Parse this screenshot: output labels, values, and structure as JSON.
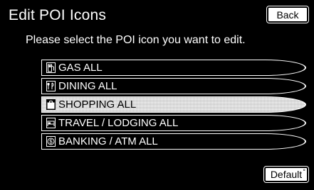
{
  "header": {
    "title": "Edit POI Icons",
    "back_label": "Back"
  },
  "instruction": "Please select the POI icon you want to edit.",
  "poi_list": [
    {
      "label": "GAS ALL",
      "icon": "gas-pump-icon",
      "selected": false
    },
    {
      "label": "DINING ALL",
      "icon": "dining-icon",
      "selected": false
    },
    {
      "label": "SHOPPING ALL",
      "icon": "shopping-bag-icon",
      "selected": true
    },
    {
      "label": "TRAVEL / LODGING ALL",
      "icon": "lodging-icon",
      "selected": false
    },
    {
      "label": "BANKING / ATM ALL",
      "icon": "dollar-icon",
      "selected": false
    }
  ],
  "footer": {
    "default_label": "Default"
  },
  "colors": {
    "background": "#000000",
    "foreground": "#ffffff"
  }
}
